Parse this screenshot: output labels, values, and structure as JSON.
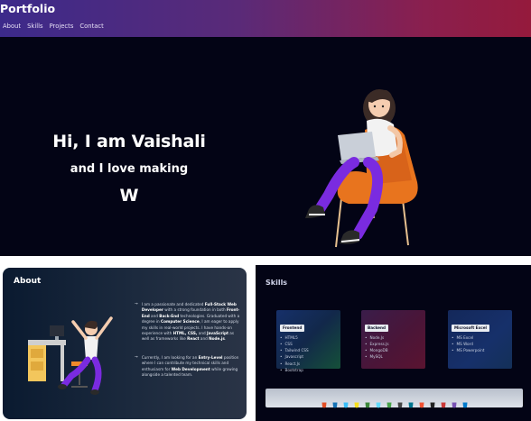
{
  "header": {
    "brand": "Portfolio",
    "nav": [
      "About",
      "Skills",
      "Projects",
      "Contact"
    ]
  },
  "hero": {
    "line1": "Hi, I am Vaishali",
    "line2": "and I love making",
    "line3": "W"
  },
  "about": {
    "title": "About",
    "para1": [
      {
        "t": "I am a passionate and dedicated ",
        "b": false
      },
      {
        "t": "Full-Stack Web Developer",
        "b": true
      },
      {
        "t": " with a strong foundation in both ",
        "b": false
      },
      {
        "t": "Front-End",
        "b": true
      },
      {
        "t": " and ",
        "b": false
      },
      {
        "t": "Back-End",
        "b": true
      },
      {
        "t": " technologies. Graduated with a degree in ",
        "b": false
      },
      {
        "t": "Computer Science",
        "b": true
      },
      {
        "t": ", I am eager to apply my skills in real-world projects. I have hands-on experience with ",
        "b": false
      },
      {
        "t": "HTML, CSS,",
        "b": true
      },
      {
        "t": " and ",
        "b": false
      },
      {
        "t": "JavaScript",
        "b": true
      },
      {
        "t": " as well as frameworks like ",
        "b": false
      },
      {
        "t": "React",
        "b": true
      },
      {
        "t": " and ",
        "b": false
      },
      {
        "t": "Node.js",
        "b": true
      },
      {
        "t": ".",
        "b": false
      }
    ],
    "para2": [
      {
        "t": "Currently, I am looking for an ",
        "b": false
      },
      {
        "t": "Entry-Level",
        "b": true
      },
      {
        "t": " position where I can contribute my technical skills and enthusiasm for ",
        "b": false
      },
      {
        "t": "Web Development",
        "b": true
      },
      {
        "t": " while growing alongside a talented team.",
        "b": false
      }
    ]
  },
  "skills": {
    "title": "Skills",
    "cards": [
      {
        "label": "Frontend",
        "items": [
          "HTML5",
          "CSS",
          "Tailwind CSS",
          "Javascript",
          "React.Js",
          "Bootstrap"
        ]
      },
      {
        "label": "Backend",
        "items": [
          "Node.Js",
          "Express.Js",
          "MongoDB",
          "MySQL"
        ]
      },
      {
        "label": "Microsoft Excel",
        "items": [
          "MS Excel",
          "MS Word",
          "MS Powerpoint"
        ]
      }
    ],
    "tech_icons": [
      "html5-icon",
      "css3-icon",
      "tailwind-icon",
      "javascript-icon",
      "nodejs-icon",
      "react-icon",
      "mongodb-icon",
      "express-icon",
      "mysql-icon",
      "git-icon",
      "github-icon",
      "npm-icon",
      "bootstrap-icon",
      "vscode-icon"
    ]
  },
  "colors": {
    "bg_dark": "#030415",
    "header_from": "#3c2a8a",
    "header_to": "#951a3c"
  }
}
